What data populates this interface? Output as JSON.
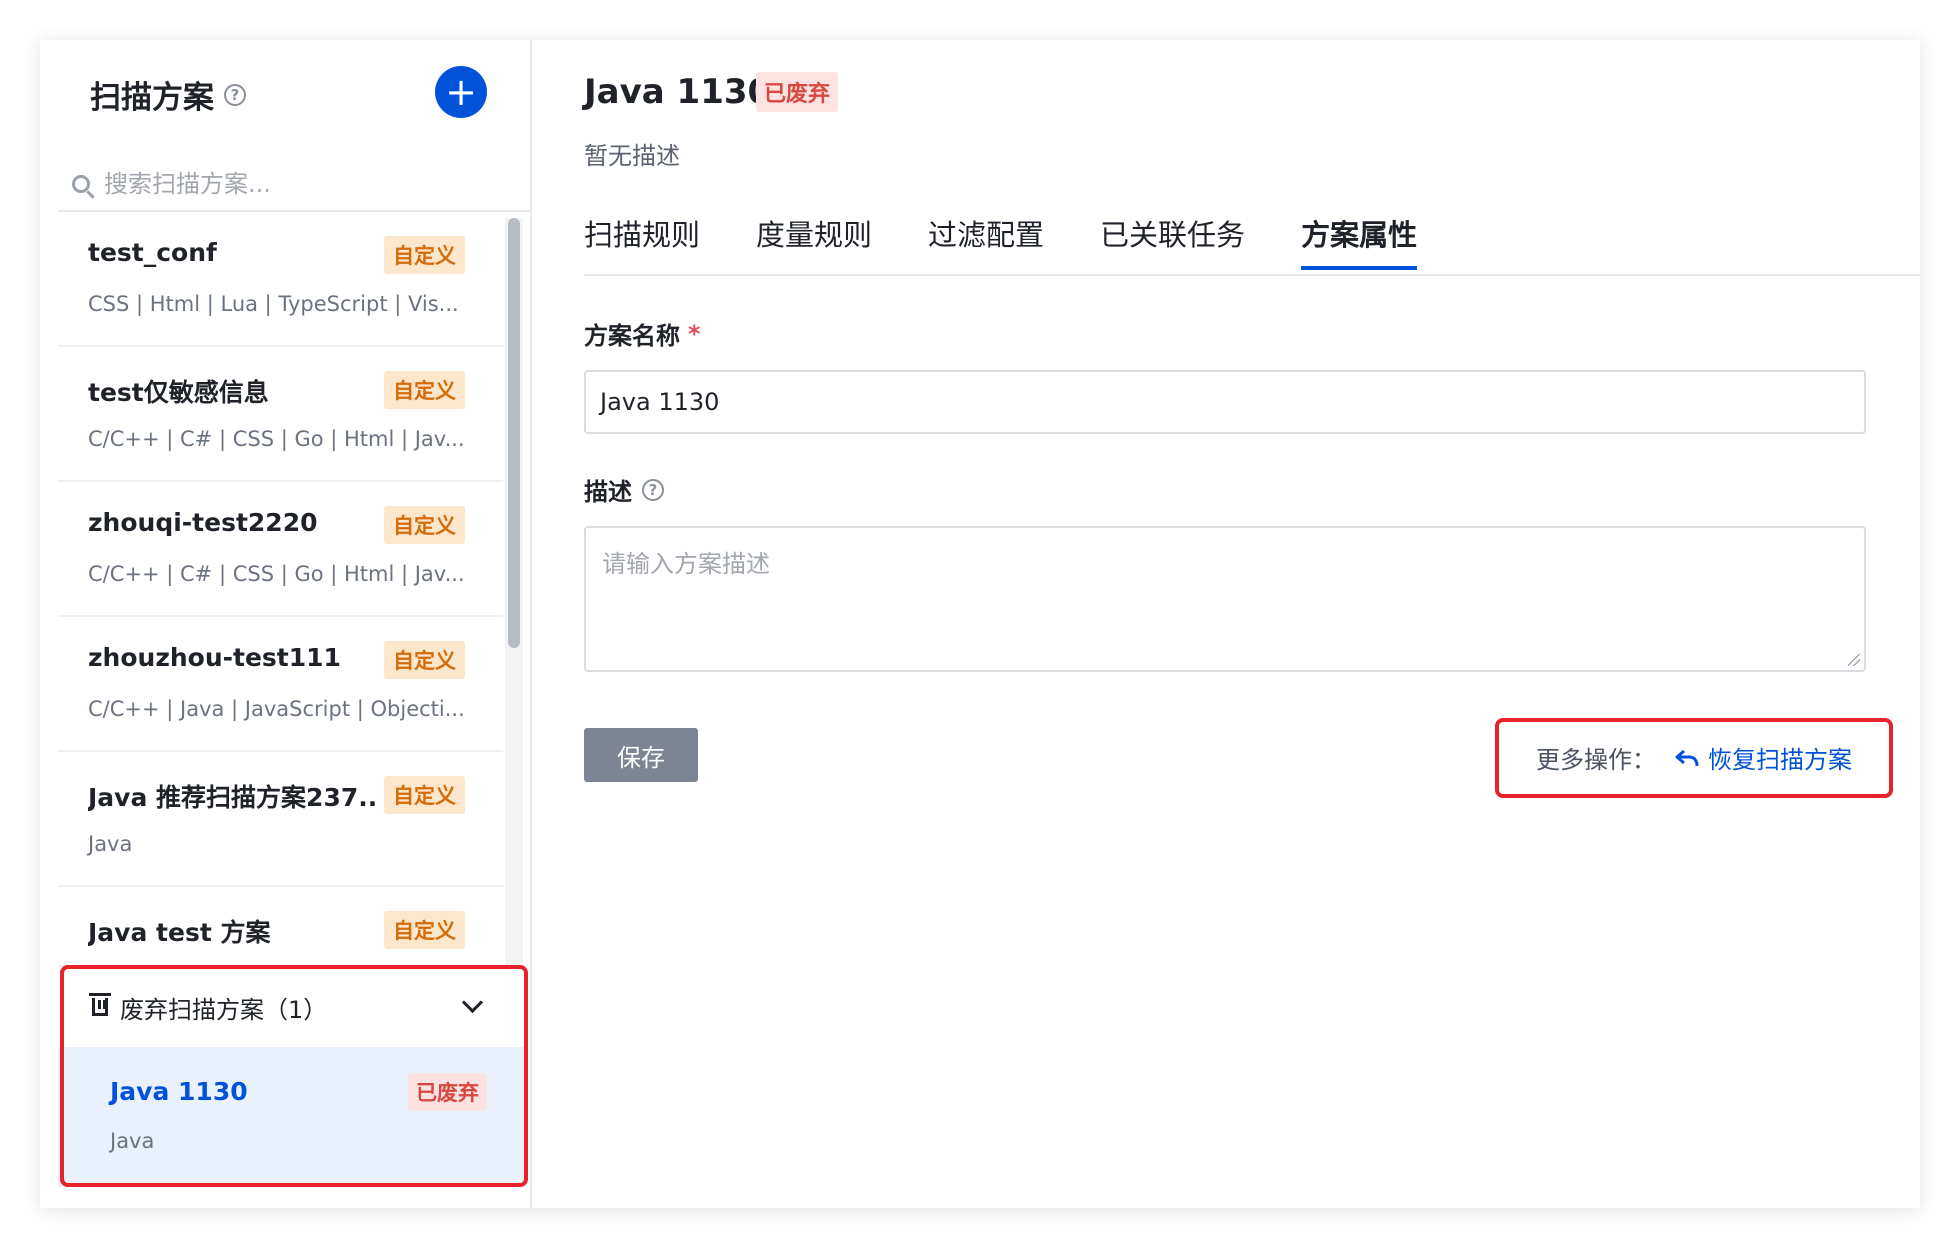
{
  "sidebar": {
    "title": "扫描方案",
    "help": "?",
    "add": "+",
    "search_placeholder": "搜索扫描方案...",
    "items": [
      {
        "name": "test_conf",
        "tag": "自定义",
        "langs": "CSS | Html | Lua | TypeScript | Vis..."
      },
      {
        "name": "test仅敏感信息",
        "tag": "自定义",
        "langs": "C/C++ | C# | CSS | Go | Html | Jav..."
      },
      {
        "name": "zhouqi-test2220",
        "tag": "自定义",
        "langs": "C/C++ | C# | CSS | Go | Html | Jav..."
      },
      {
        "name": "zhouzhou-test111",
        "tag": "自定义",
        "langs": "C/C++ | Java | JavaScript | Objecti..."
      },
      {
        "name": "Java 推荐扫描方案237...",
        "tag": "自定义",
        "langs": "Java"
      },
      {
        "name": "Java test 方案",
        "tag": "自定义",
        "langs": ""
      }
    ],
    "deprecated": {
      "title": "废弃扫描方案（1）",
      "item": {
        "name": "Java 1130",
        "tag": "已废弃",
        "langs": "Java"
      }
    }
  },
  "main": {
    "title": "Java 1130",
    "status_tag": "已废弃",
    "description": "暂无描述",
    "tabs": [
      "扫描规则",
      "度量规则",
      "过滤配置",
      "已关联任务",
      "方案属性"
    ],
    "active_tab": 4,
    "form": {
      "name_label": "方案名称",
      "required_mark": "*",
      "name_value": "Java 1130",
      "desc_label": "描述",
      "desc_placeholder": "请输入方案描述"
    },
    "save_label": "保存",
    "more_ops_label": "更多操作：",
    "restore_label": "恢复扫描方案"
  },
  "colors": {
    "accent": "#0052d9",
    "highlight_box": "#e8222b",
    "custom_tag_bg": "#fde7cc",
    "deprecated_tag_bg": "#fde2e2"
  }
}
